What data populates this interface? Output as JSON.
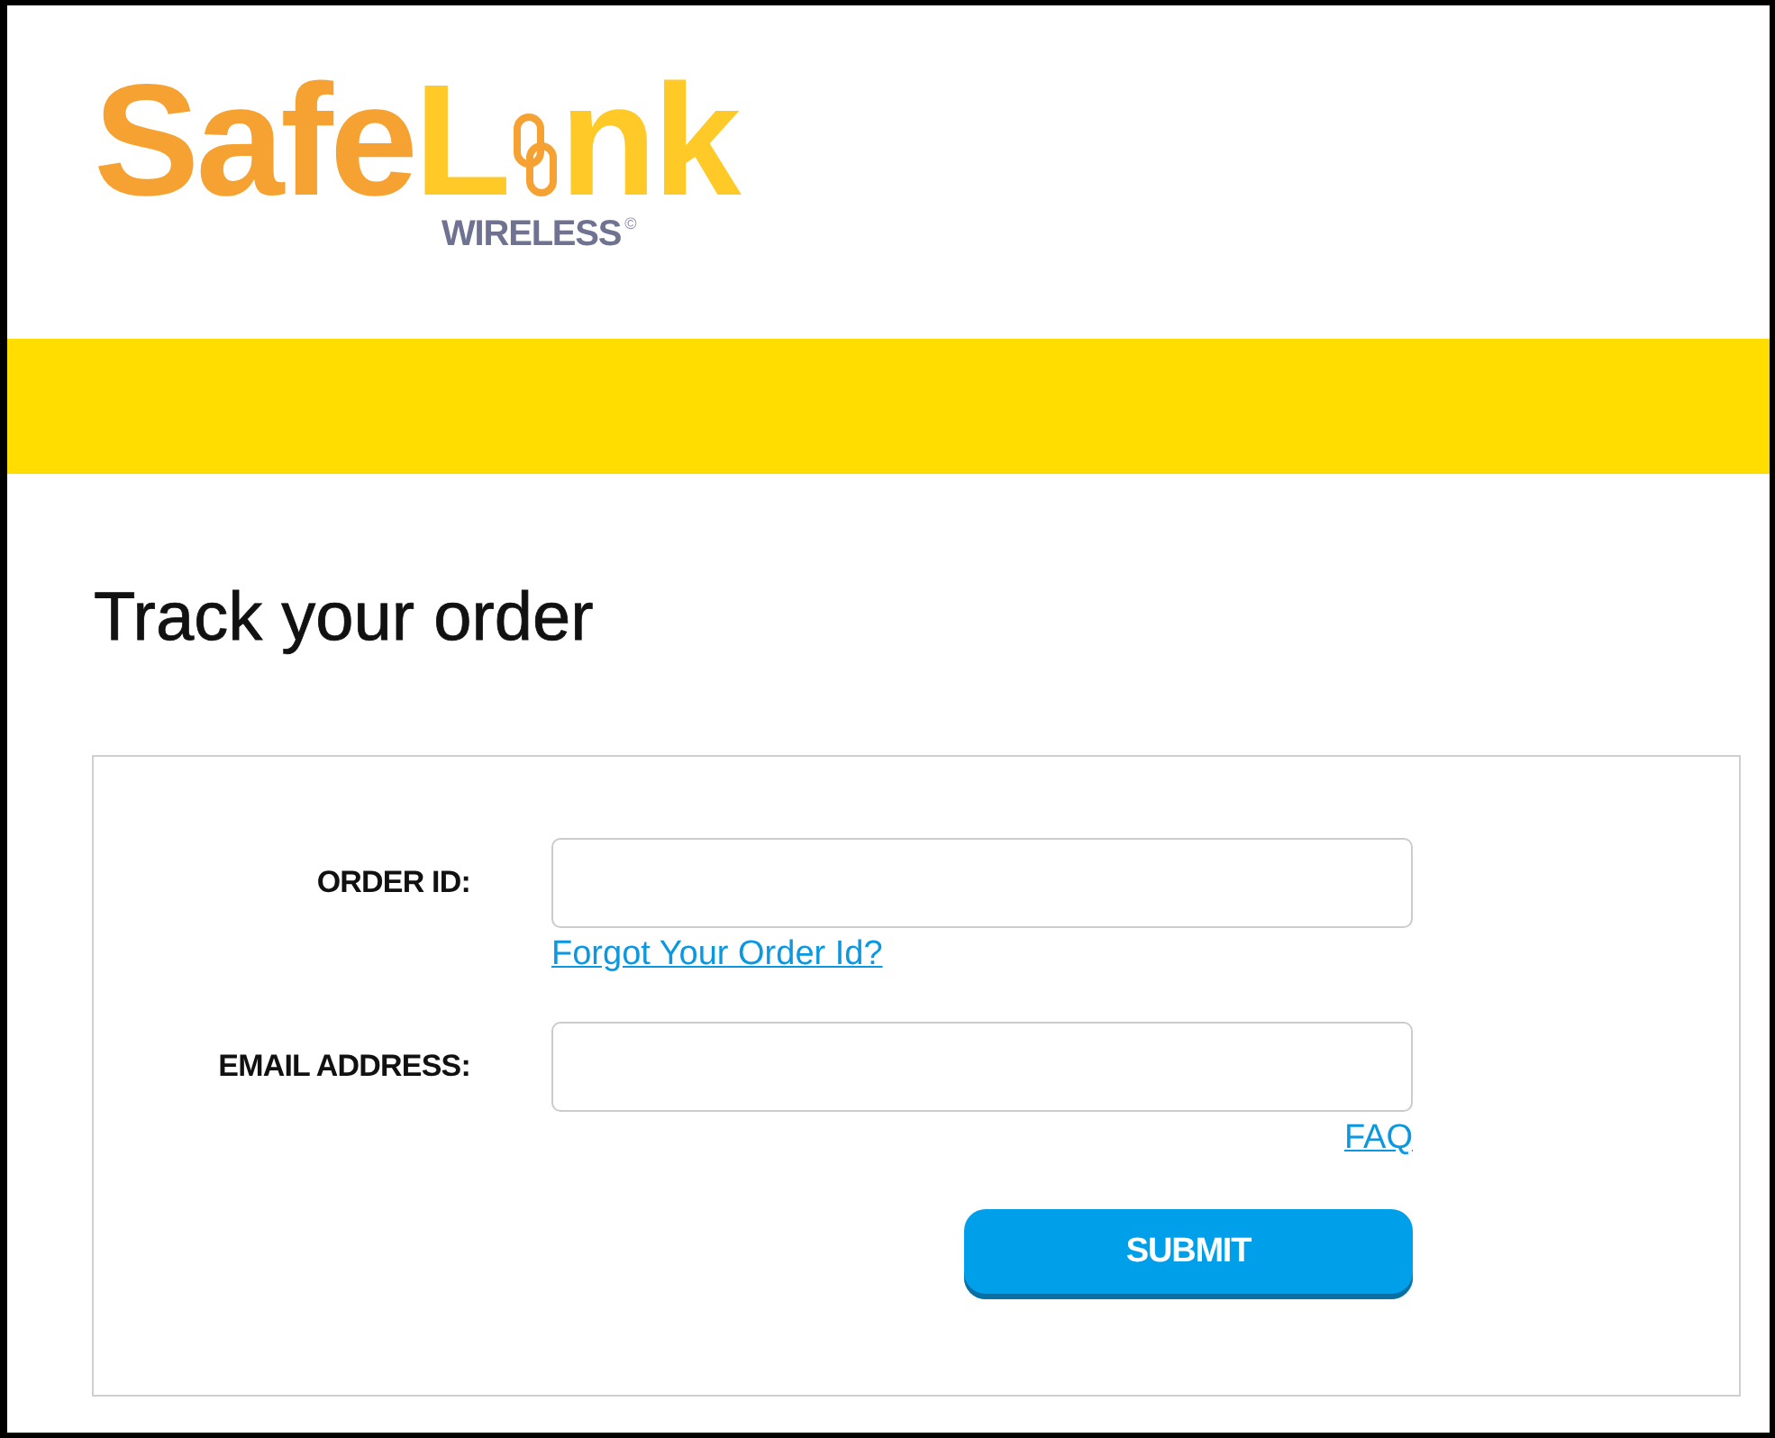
{
  "logo": {
    "brand_start": "Safe",
    "brand_letter": "L",
    "brand_end": "nk",
    "tagline": "WIRELESS",
    "mark": "©"
  },
  "page_title": "Track your order",
  "form": {
    "fields": [
      {
        "label": "ORDER ID:",
        "help_link": "Forgot Your Order Id?"
      },
      {
        "label": "EMAIL ADDRESS:",
        "help_link": "FAQ"
      }
    ],
    "submit": "SUBMIT"
  }
}
